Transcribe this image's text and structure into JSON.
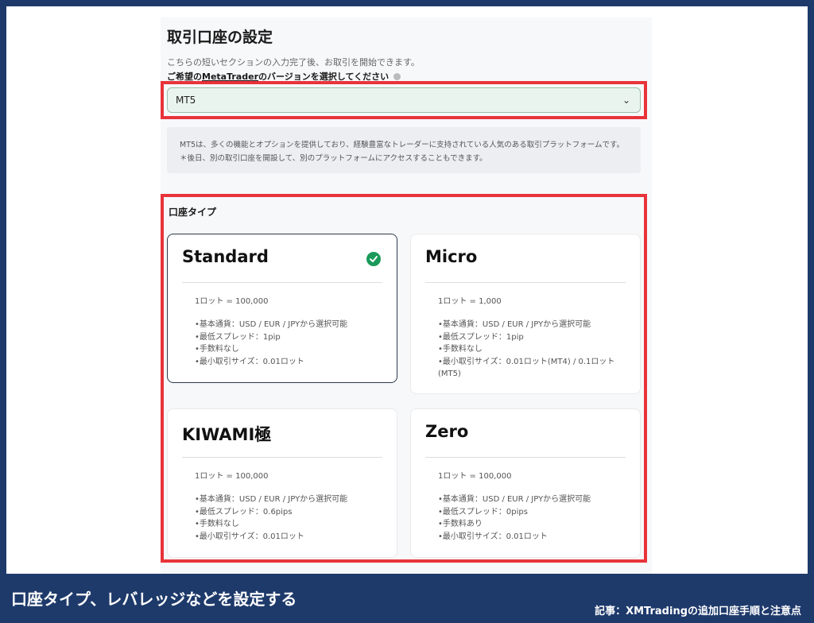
{
  "form": {
    "title": "取引口座の設定",
    "subtitle": "こちらの短いセクションの入力完了後、お取引を開始できます。",
    "platform_label_prefix": "ご希望の",
    "platform_label_link": "MetaTrader",
    "platform_label_suffix": "のバージョンを選択してください",
    "platform_value": "MT5",
    "platform_note": "MT5は、多くの機能とオプションを提供しており、経験豊富なトレーダーに支持されている人気のある取引プラットフォームです。＊後日、別の取引口座を開設して、別のプラットフォームにアクセスすることもできます。",
    "account_type_title": "口座タイプ"
  },
  "accounts": [
    {
      "name": "Standard",
      "lot": "1ロット = 100,000",
      "features": [
        "•基本通貨：USD / EUR / JPYから選択可能",
        "•最低スプレッド：1pip",
        "•手数料なし",
        "•最小取引サイズ：0.01ロット"
      ],
      "selected": true
    },
    {
      "name": "Micro",
      "lot": "1ロット = 1,000",
      "features": [
        "•基本通貨：USD / EUR / JPYから選択可能",
        "•最低スプレッド：1pip",
        "•手数料なし",
        "•最小取引サイズ：0.01ロット(MT4) / 0.1ロット (MT5)"
      ],
      "selected": false
    },
    {
      "name": "KIWAMI極",
      "lot": "1ロット = 100,000",
      "features": [
        "•基本通貨：USD / EUR / JPYから選択可能",
        "•最低スプレッド：0.6pips",
        "•手数料なし",
        "•最小取引サイズ：0.01ロット"
      ],
      "selected": false
    },
    {
      "name": "Zero",
      "lot": "1ロット = 100,000",
      "features": [
        "•基本通貨：USD / EUR / JPYから選択可能",
        "•最低スプレッド：0pips",
        "•手数料あり",
        "•最小取引サイズ：0.01ロット"
      ],
      "selected": false
    }
  ],
  "footer": {
    "caption": "口座タイプ、レバレッジなどを設定する",
    "article": "記事：XMTradingの追加口座手順と注意点"
  },
  "colors": {
    "highlight": "#e8333a",
    "frame": "#1e3a6b",
    "check": "#1a9a5a"
  }
}
